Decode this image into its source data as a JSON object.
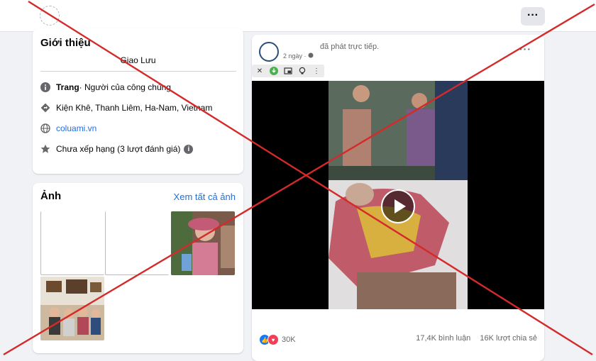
{
  "intro": {
    "title": "Giới thiệu",
    "subtitle": "Giao Lưu",
    "category_bold": "Trang",
    "category_rest": " · Người của công chúng",
    "location": "Kiện Khê, Thanh Liêm, Ha-Nam, Vietnam",
    "website": "coluami.vn",
    "rating": "Chưa xếp hạng (3 lượt đánh giá)"
  },
  "photos": {
    "title": "Ảnh",
    "see_all": "Xem tất cả ảnh"
  },
  "post": {
    "action": "đã phát trực tiếp.",
    "time": "2 ngày ·",
    "reactions": "30K",
    "comments": "17,4K bình luận",
    "shares": "16K lượt chia sẻ"
  },
  "colors": {
    "accent": "#216fdb",
    "cross": "#d42a2a",
    "background": "#f0f2f5"
  },
  "icons": [
    "more-icon",
    "info-icon",
    "directions-icon",
    "globe-icon",
    "star-icon",
    "close-icon",
    "download-icon",
    "bulb-icon",
    "play-icon",
    "like-icon",
    "love-icon",
    "privacy-globe-icon"
  ]
}
